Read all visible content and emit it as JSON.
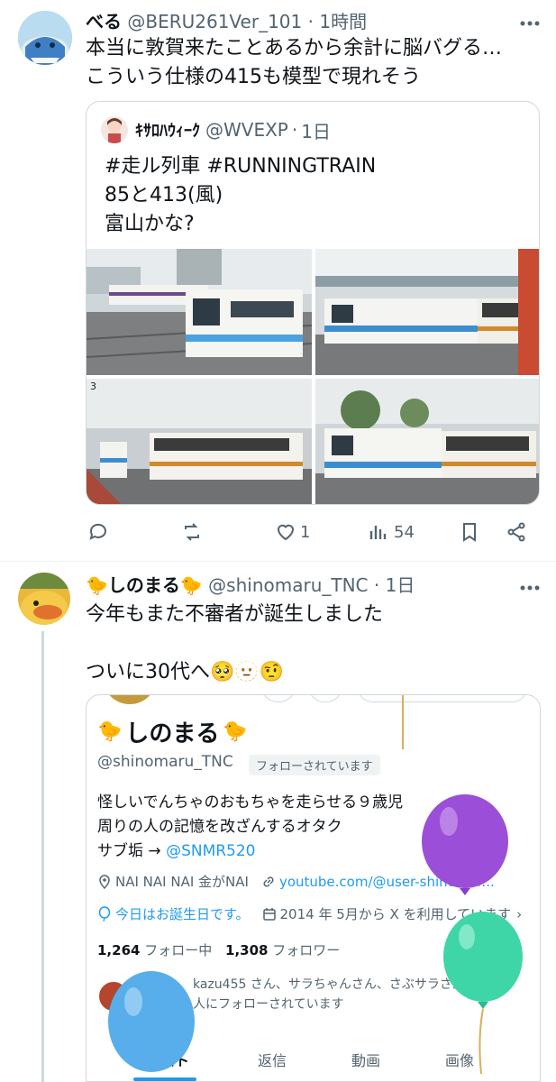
{
  "tweet1": {
    "display_name": "べる",
    "handle": "@BERU261Ver_101",
    "time": "1時間",
    "body_lines": [
      "本当に敦賀来たことあるから余計に脳バグる…",
      "こういう仕様の415も模型で現れそう"
    ],
    "quote": {
      "display_name": "ｷｻﾛﾊｳｨｰｸ",
      "handle": "@WVEXP",
      "time": "1日",
      "text_lines": [
        "#走ル列車 #RUNNINGTRAIN",
        "85と413(風)",
        "富山かな?"
      ]
    },
    "stats": {
      "likes": "1",
      "views": "54"
    }
  },
  "tweet2": {
    "display_name": "🐤しのまる🐤",
    "handle": "@shinomaru_TNC",
    "time": "1日",
    "body_line1": "今年もまた不審者が誕生しました",
    "body_line2": "ついに30代へ🥺🫥🤨",
    "profile": {
      "name": "しのまる",
      "handle": "@shinomaru_TNC",
      "follows_you": "フォローされています",
      "bio": [
        "怪しいでんちゃのおもちゃを走らせる９歳児",
        "周りの人の記憶を改ざんするオタク",
        "サブ垢 → "
      ],
      "sub_account": "@SNMR520",
      "location": "NAI NAI NAI 金がNAI",
      "website": "youtube.com/@user-shinomar...",
      "birthday": "今日はお誕生日です。",
      "joined": "2014 年 5月から X を利用しています",
      "following_count": "1,264",
      "following_label": "フォロー中",
      "followers_count": "1,308",
      "followers_label": "フォロワー",
      "followed_by": "kazu455 さん、サラちゃんさん、さぶサラさん、他31 人にフォローされています",
      "tabs": [
        "ポスト",
        "返信",
        "動画",
        "画像"
      ]
    }
  },
  "colors": {
    "accent": "#1d9bf0",
    "muted": "#536471",
    "border": "#cfd9de"
  }
}
